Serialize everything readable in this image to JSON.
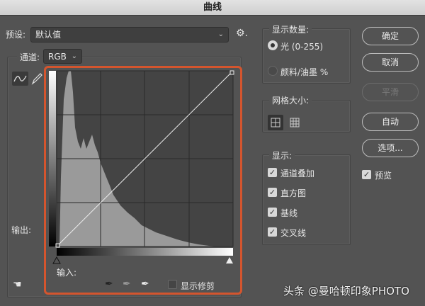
{
  "window": {
    "title": "曲线"
  },
  "preset": {
    "label": "预设:",
    "value": "默认值"
  },
  "channel": {
    "label": "通道:",
    "value": "RGB"
  },
  "graph": {
    "output_label": "输出:",
    "input_label": "输入:",
    "show_clipping": "显示修剪",
    "show_clipping_checked": false
  },
  "display_amount": {
    "title": "显示数量:",
    "options": [
      "光 (0-255)",
      "颜料/油墨 %"
    ],
    "selected": 0
  },
  "grid_size": {
    "title": "网格大小:"
  },
  "show": {
    "title": "显示:",
    "items": [
      "通道叠加",
      "直方图",
      "基线",
      "交叉线"
    ]
  },
  "buttons": {
    "ok": "确定",
    "cancel": "取消",
    "smooth": "平滑",
    "auto": "自动",
    "options": "选项..."
  },
  "preview": {
    "label": "预览",
    "checked": true
  },
  "watermark": "头条 @曼哈顿印象PHOTO",
  "colors": {
    "highlight": "#d4552e",
    "background": "#535353"
  }
}
